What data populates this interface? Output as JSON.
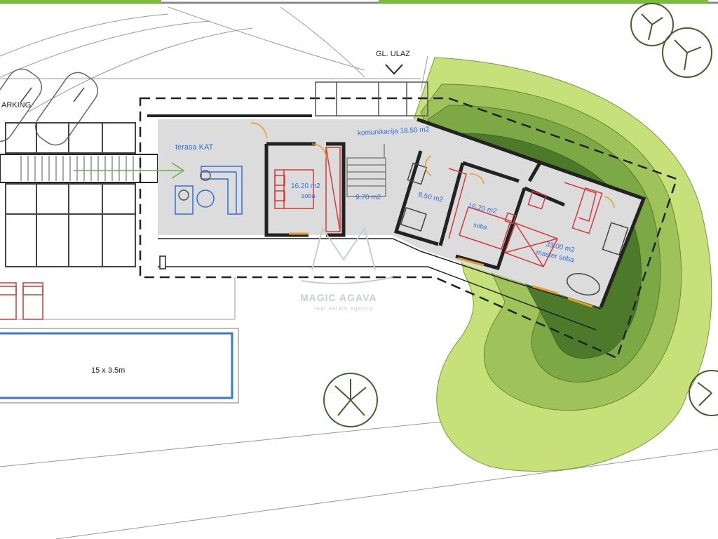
{
  "labels": {
    "parking": "ARKING",
    "entrance": "GL. ULAZ",
    "terrace": "terasa KAT",
    "communication": "komunikacija 18.50 m2",
    "room1_area": "16.20 m2",
    "room1_name": "soba",
    "stair_area": "9.70 m2",
    "room2_area": "8.50 m2",
    "room3_area": "16.20 m2",
    "room3_name": "soba",
    "master_area": "33.00 m2",
    "master_name": "master soba",
    "pool_size": "15 x 3.5m",
    "watermark_name": "MAGIC AGAVA",
    "watermark_sub": "real estate agency"
  },
  "colors": {
    "wall": "#222222",
    "floor": "#dcdcdc",
    "furniture_blue": "#2f6fd6",
    "furniture_red": "#d33a3a",
    "door_yellow": "#e0a020",
    "lime": "#c6e07a",
    "green_mid": "#9fc35a",
    "green_dark": "#6f9a3c",
    "green_darkest": "#4c7a2a",
    "pool_border": "#3a7ad0"
  },
  "icons": [
    "car-icon",
    "tree-icon",
    "arrow-icon",
    "sofa-icon",
    "bed-icon",
    "bathtub-icon",
    "chevron-down-icon"
  ]
}
